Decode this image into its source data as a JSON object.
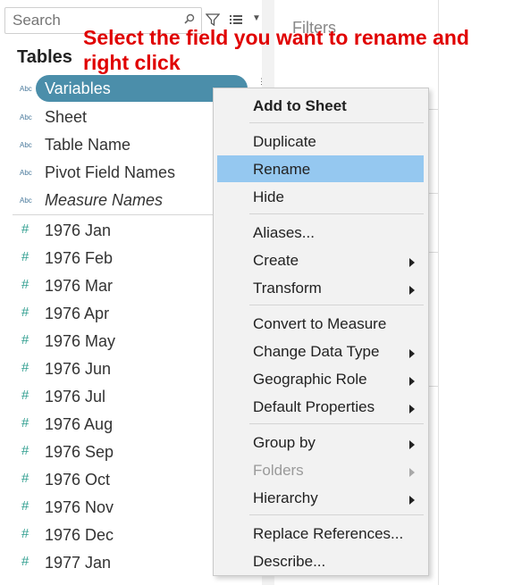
{
  "search": {
    "placeholder": "Search"
  },
  "data_pane": {
    "heading": "Tables",
    "fields": [
      {
        "type": "Abc",
        "label": "Variables"
      },
      {
        "type": "Abc",
        "label": "Sheet"
      },
      {
        "type": "Abc",
        "label": "Table Name"
      },
      {
        "type": "Abc",
        "label": "Pivot Field Names"
      },
      {
        "type": "Abc",
        "label": "Measure Names"
      }
    ],
    "measures": [
      {
        "type": "#",
        "label": "1976 Jan"
      },
      {
        "type": "#",
        "label": "1976 Feb"
      },
      {
        "type": "#",
        "label": "1976 Mar"
      },
      {
        "type": "#",
        "label": "1976 Apr"
      },
      {
        "type": "#",
        "label": "1976 May"
      },
      {
        "type": "#",
        "label": "1976 Jun"
      },
      {
        "type": "#",
        "label": "1976 Jul"
      },
      {
        "type": "#",
        "label": "1976 Aug"
      },
      {
        "type": "#",
        "label": "1976 Sep"
      },
      {
        "type": "#",
        "label": "1976 Oct"
      },
      {
        "type": "#",
        "label": "1976 Nov"
      },
      {
        "type": "#",
        "label": "1976 Dec"
      },
      {
        "type": "#",
        "label": "1977 Jan"
      }
    ]
  },
  "filters": {
    "title": "Filters"
  },
  "annotation": "Select the field you want to rename and right click",
  "context_menu": {
    "items": [
      {
        "label": "Add to Sheet"
      },
      {
        "label": "Duplicate"
      },
      {
        "label": "Rename"
      },
      {
        "label": "Hide"
      },
      {
        "label": "Aliases..."
      },
      {
        "label": "Create"
      },
      {
        "label": "Transform"
      },
      {
        "label": "Convert to Measure"
      },
      {
        "label": "Change Data Type"
      },
      {
        "label": "Geographic Role"
      },
      {
        "label": "Default Properties"
      },
      {
        "label": "Group by"
      },
      {
        "label": "Folders"
      },
      {
        "label": "Hierarchy"
      },
      {
        "label": "Replace References..."
      },
      {
        "label": "Describe..."
      }
    ]
  },
  "colors": {
    "selected_pill": "#4b8eaa",
    "menu_highlight": "#95c8f0",
    "annotation": "#e00000",
    "measure_icon": "#2f9e8f"
  }
}
